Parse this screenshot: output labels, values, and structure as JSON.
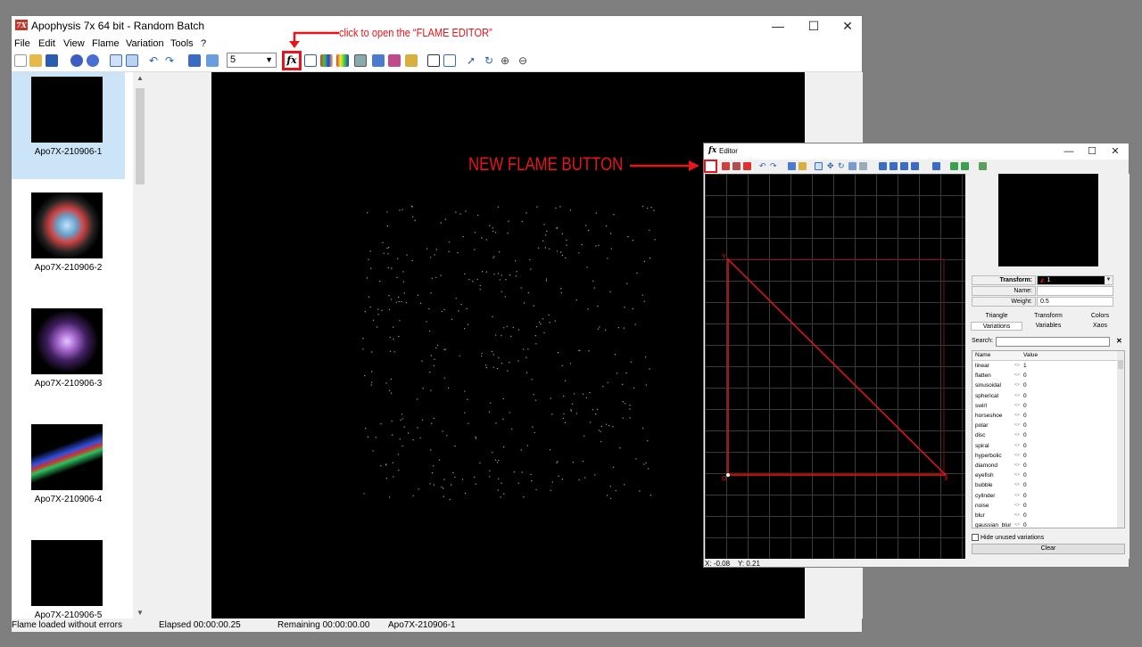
{
  "main": {
    "title": "Apophysis 7x 64 bit - Random Batch",
    "app_icon_text": "7X",
    "window_controls": {
      "minimize": "—",
      "maximize": "☐",
      "close": "✕"
    },
    "menu": [
      "File",
      "Edit",
      "View",
      "Flame",
      "Variation",
      "Tools",
      "?"
    ],
    "toolbar": {
      "combo_value": "5",
      "fx_button": "fx"
    },
    "thumbnails": [
      {
        "label": "Apo7X-210906-1",
        "selected": true
      },
      {
        "label": "Apo7X-210906-2",
        "selected": false
      },
      {
        "label": "Apo7X-210906-3",
        "selected": false
      },
      {
        "label": "Apo7X-210906-4",
        "selected": false
      },
      {
        "label": "Apo7X-210906-5",
        "selected": false
      }
    ],
    "status": {
      "message": "Flame loaded without errors",
      "elapsed": "Elapsed 00:00:00.25",
      "remaining": "Remaining 00:00:00.00",
      "flame_name": "Apo7X-210906-1"
    }
  },
  "annotations": {
    "flame_editor_hint": "click to open the “FLAME EDITOR”",
    "new_flame_button": "NEW FLAME BUTTON",
    "color": "#e8141c"
  },
  "editor": {
    "title": "Editor",
    "icon_text": "fx",
    "window_controls": {
      "minimize": "—",
      "maximize": "☐",
      "close": "✕"
    },
    "triangle_labels": {
      "y": "Y",
      "o": "O",
      "x": "X"
    },
    "coords": {
      "x": "X: -0.08",
      "y": "Y: 0.21"
    },
    "transform": {
      "label": "Transform:",
      "value": "1",
      "name_label": "Name:",
      "name_value": "",
      "weight_label": "Weight:",
      "weight_value": "0.5"
    },
    "tabs_row1": [
      "Triangle",
      "Transform",
      "Colors"
    ],
    "tabs_row2": [
      "Variations",
      "Variables",
      "Xaos"
    ],
    "search_label": "Search:",
    "table_headers": {
      "name": "Name",
      "value": "Value"
    },
    "variations": [
      {
        "name": "linear",
        "value": "1"
      },
      {
        "name": "flatten",
        "value": "0"
      },
      {
        "name": "sinusoidal",
        "value": "0"
      },
      {
        "name": "spherical",
        "value": "0"
      },
      {
        "name": "swirl",
        "value": "0"
      },
      {
        "name": "horseshoe",
        "value": "0"
      },
      {
        "name": "polar",
        "value": "0"
      },
      {
        "name": "disc",
        "value": "0"
      },
      {
        "name": "spiral",
        "value": "0"
      },
      {
        "name": "hyperbolic",
        "value": "0"
      },
      {
        "name": "diamond",
        "value": "0"
      },
      {
        "name": "eyefish",
        "value": "0"
      },
      {
        "name": "bubble",
        "value": "0"
      },
      {
        "name": "cylinder",
        "value": "0"
      },
      {
        "name": "noise",
        "value": "0"
      },
      {
        "name": "blur",
        "value": "0"
      },
      {
        "name": "gaussian_blur",
        "value": "0"
      }
    ],
    "hide_unused": "Hide unused variations",
    "clear_button": "Clear"
  }
}
